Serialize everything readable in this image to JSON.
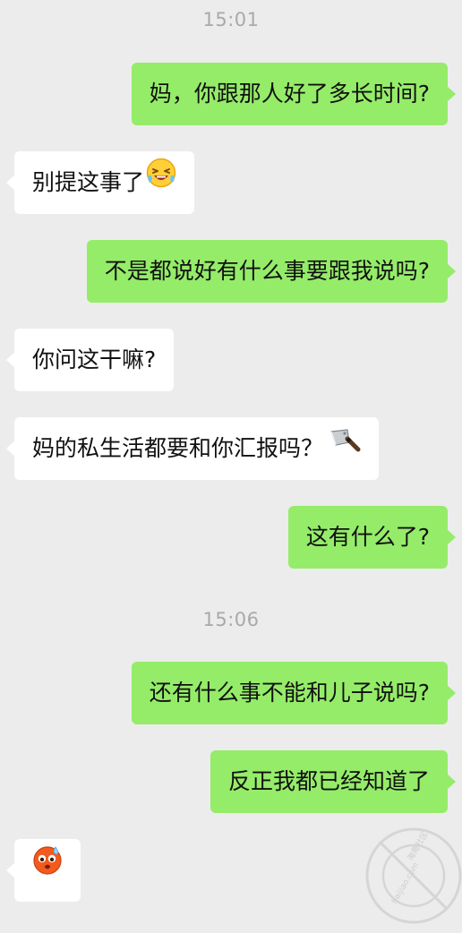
{
  "timestamps": [
    "15:01",
    "15:06"
  ],
  "messages": [
    {
      "side": "out",
      "text": "妈，你跟那人好了多长时间?"
    },
    {
      "side": "in",
      "text": "别提这事了",
      "emoji": "laughing-face-icon"
    },
    {
      "side": "out",
      "text": "不是都说好有什么事要跟我说吗?"
    },
    {
      "side": "in",
      "text": "你问这干嘛?"
    },
    {
      "side": "in",
      "text": "妈的私生活都要和你汇报吗？",
      "emoji": "cleaver-knife-icon"
    },
    {
      "side": "out",
      "text": "这有什么了?"
    },
    {
      "side": "out",
      "text": "还有什么事不能和儿子说吗?"
    },
    {
      "side": "out",
      "text": "反正我都已经知道了"
    },
    {
      "side": "in",
      "text": "",
      "emoji": "sweating-face-icon"
    }
  ],
  "watermark": {
    "line1": "海角社区",
    "line2": "haijiao.com"
  },
  "colors": {
    "background": "#ececec",
    "outgoing": "#95ec69",
    "incoming": "#ffffff",
    "timestamp": "#a9a9a9"
  }
}
